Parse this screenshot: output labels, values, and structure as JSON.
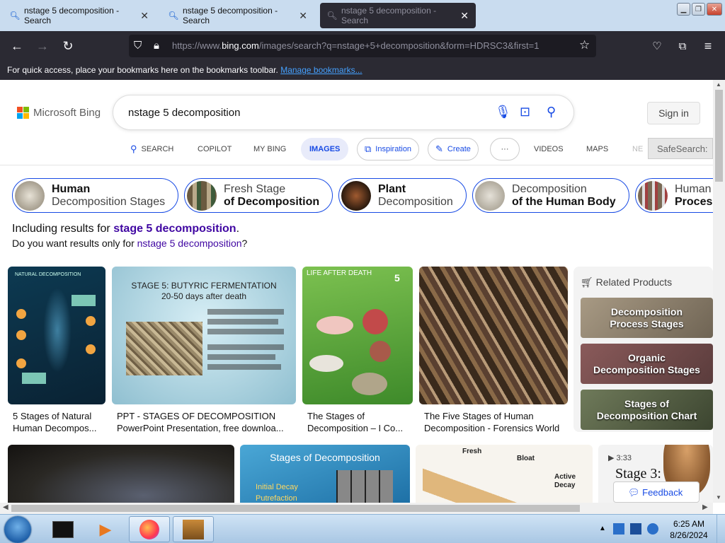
{
  "browser": {
    "tabs": [
      {
        "title": "nstage 5 decomposition - Search",
        "active": false
      },
      {
        "title": "nstage 5 decomposition - Search",
        "active": false
      },
      {
        "title": "nstage 5 decomposition - Search",
        "active": true
      }
    ],
    "url_prefix": "https://www.",
    "url_domain": "bing.com",
    "url_path": "/images/search?q=nstage+5+decomposition&form=HDRSC3&first=1",
    "bookmarks_message": "For quick access, place your bookmarks here on the bookmarks toolbar.",
    "bookmarks_link": "Manage bookmarks..."
  },
  "bing": {
    "logo_text": "Microsoft Bing",
    "query": "nstage 5 decomposition",
    "signin_label": "Sign in",
    "scopes": {
      "search": "SEARCH",
      "copilot": "COPILOT",
      "mybing": "MY BING",
      "images": "IMAGES",
      "inspiration": "Inspiration",
      "create": "Create",
      "more": "···",
      "videos": "VIDEOS",
      "maps": "MAPS",
      "news": "NE"
    },
    "safesearch": "SafeSearch:",
    "chips": [
      {
        "line1": "Human",
        "line2": "Decomposition Stages"
      },
      {
        "line1": "Fresh Stage",
        "line2": "of Decomposition"
      },
      {
        "line1": "Plant",
        "line2": "Decomposition"
      },
      {
        "line1": "Decomposition",
        "line2": "of the Human Body"
      },
      {
        "line1": "Human",
        "line2": "Process"
      }
    ],
    "including_prefix": "Including results for ",
    "including_term": "stage 5 decomposition",
    "including_suffix": ".",
    "onlyfor_prefix": "Do you want results only for ",
    "onlyfor_term": "nstage 5 decomposition",
    "onlyfor_suffix": "?",
    "results": [
      {
        "cap1": "5 Stages of Natural",
        "cap2": "Human Decompos..."
      },
      {
        "cap1": "PPT - STAGES OF DECOMPOSITION",
        "cap2": "PowerPoint Presentation, free downloa..."
      },
      {
        "cap1": "The Stages of",
        "cap2": "Decomposition – I Co..."
      },
      {
        "cap1": "The Five Stages of Human",
        "cap2": "Decomposition - Forensics World"
      }
    ],
    "result_images": {
      "r1_title": "NATURAL DECOMPOSITION",
      "r2_title1": "STAGE 5: BUTYRIC FERMENTATION",
      "r2_title2": "20-50 days after death",
      "r3_title": "LIFE AFTER DEATH",
      "r3_num": "5"
    },
    "related": {
      "header": "Related Products",
      "items": [
        {
          "line1": "Decomposition",
          "line2": "Process Stages"
        },
        {
          "line1": "Organic",
          "line2": "Decomposition Stages"
        },
        {
          "line1": "Stages of",
          "line2": "Decomposition Chart"
        }
      ]
    },
    "row2": {
      "card2_title": "Stages of Decomposition",
      "card2_items": [
        "Initial Decay",
        "Putrefaction"
      ],
      "card3_labels": [
        "Fresh",
        "Bloat",
        "Active Decay"
      ],
      "card4_duration": "3:33",
      "card4_title": "Stage 3:"
    },
    "feedback": "Feedback"
  },
  "taskbar": {
    "time": "6:25 AM",
    "date": "8/26/2024"
  },
  "colors": {
    "bing_blue": "#174ae4",
    "link_purple": "#4007a2",
    "firefox_dark": "#2b2a33"
  }
}
